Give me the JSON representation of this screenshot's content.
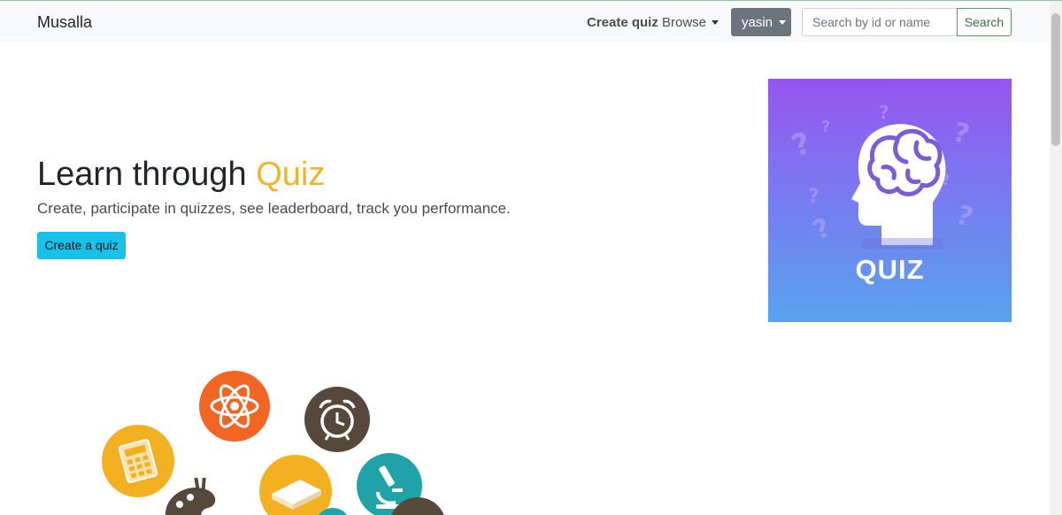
{
  "navbar": {
    "brand": "Musalla",
    "create_quiz": "Create quiz",
    "browse": "Browse",
    "user": "yasin",
    "search_placeholder": "Search by id or name",
    "search_button": "Search"
  },
  "hero": {
    "title_main": "Learn through",
    "title_accent": "Quiz",
    "subtitle": "Create, participate in quizzes, see leaderboard, track you performance.",
    "cta_button": "Create a quiz"
  },
  "quiz_image": {
    "label": "QUIZ"
  },
  "colors": {
    "accent_yellow": "#f0b429",
    "cta_cyan": "#17c1e8",
    "user_gray": "#6c757d",
    "search_green": "#5a9a6a",
    "circle_orange": "#f26522",
    "circle_brown": "#56483a",
    "circle_yellow": "#f3b122",
    "circle_teal": "#1fa3a8"
  },
  "illustration_icons": [
    "atom-icon",
    "alarm-clock-icon",
    "calculator-icon",
    "palette-icon",
    "book-icon",
    "microscope-icon"
  ]
}
